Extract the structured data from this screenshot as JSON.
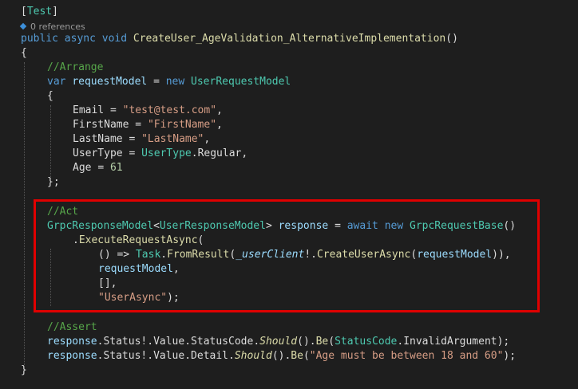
{
  "editor": {
    "codelens": "0 references",
    "lines": {
      "attr_test": "Test",
      "signature_public": "public",
      "signature_async": "async",
      "signature_void": "void",
      "method_name": "CreateUser_AgeValidation_AlternativeImplementation",
      "arrange_comment": "//Arrange",
      "var_kw": "var",
      "request_model_var": "requestModel",
      "new_kw": "new",
      "user_request_model_type": "UserRequestModel",
      "email_prop": "Email",
      "email_value": "\"test@test.com\"",
      "firstname_prop": "FirstName",
      "firstname_value": "\"FirstName\"",
      "lastname_prop": "LastName",
      "lastname_value": "\"LastName\"",
      "usertype_prop": "UserType",
      "usertype_type": "UserType",
      "usertype_value": "Regular",
      "age_prop": "Age",
      "age_value": "61",
      "act_comment": "//Act",
      "grpc_response_type": "GrpcResponseModel",
      "user_response_type": "UserResponseModel",
      "response_var": "response",
      "await_kw": "await",
      "grpc_request_base": "GrpcRequestBase",
      "execute_method": "ExecuteRequestAsync",
      "task_type": "Task",
      "from_result": "FromResult",
      "user_client_field": "_userClient",
      "create_user_async": "CreateUserAsync",
      "request_model_arg": "requestModel",
      "empty_collection": "[],",
      "user_async_str": "\"UserAsync\"",
      "assert_comment": "//Assert",
      "status_prop": "Status",
      "value_prop": "Value",
      "status_code_prop": "StatusCode",
      "should_method": "Should",
      "be_method": "Be",
      "status_code_type": "StatusCode",
      "invalid_argument": "InvalidArgument",
      "detail_prop": "Detail",
      "age_message": "\"Age must be between 18 and 60\""
    }
  },
  "colors": {
    "background": "#1e1e1e",
    "highlight_border": "#e00000"
  }
}
